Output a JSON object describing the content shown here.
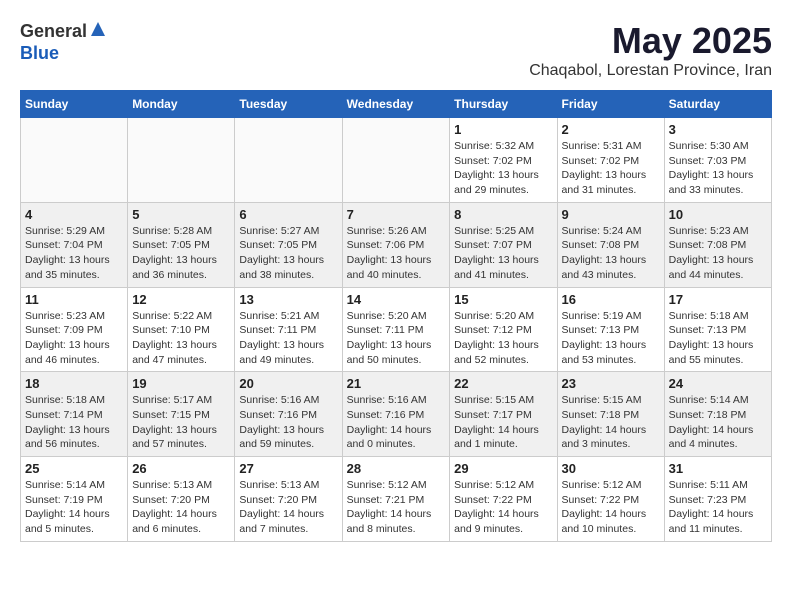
{
  "header": {
    "logo_general": "General",
    "logo_blue": "Blue",
    "month_title": "May 2025",
    "location": "Chaqabol, Lorestan Province, Iran"
  },
  "days_of_week": [
    "Sunday",
    "Monday",
    "Tuesday",
    "Wednesday",
    "Thursday",
    "Friday",
    "Saturday"
  ],
  "weeks": [
    [
      {
        "day": "",
        "info": ""
      },
      {
        "day": "",
        "info": ""
      },
      {
        "day": "",
        "info": ""
      },
      {
        "day": "",
        "info": ""
      },
      {
        "day": "1",
        "info": "Sunrise: 5:32 AM\nSunset: 7:02 PM\nDaylight: 13 hours\nand 29 minutes."
      },
      {
        "day": "2",
        "info": "Sunrise: 5:31 AM\nSunset: 7:02 PM\nDaylight: 13 hours\nand 31 minutes."
      },
      {
        "day": "3",
        "info": "Sunrise: 5:30 AM\nSunset: 7:03 PM\nDaylight: 13 hours\nand 33 minutes."
      }
    ],
    [
      {
        "day": "4",
        "info": "Sunrise: 5:29 AM\nSunset: 7:04 PM\nDaylight: 13 hours\nand 35 minutes."
      },
      {
        "day": "5",
        "info": "Sunrise: 5:28 AM\nSunset: 7:05 PM\nDaylight: 13 hours\nand 36 minutes."
      },
      {
        "day": "6",
        "info": "Sunrise: 5:27 AM\nSunset: 7:05 PM\nDaylight: 13 hours\nand 38 minutes."
      },
      {
        "day": "7",
        "info": "Sunrise: 5:26 AM\nSunset: 7:06 PM\nDaylight: 13 hours\nand 40 minutes."
      },
      {
        "day": "8",
        "info": "Sunrise: 5:25 AM\nSunset: 7:07 PM\nDaylight: 13 hours\nand 41 minutes."
      },
      {
        "day": "9",
        "info": "Sunrise: 5:24 AM\nSunset: 7:08 PM\nDaylight: 13 hours\nand 43 minutes."
      },
      {
        "day": "10",
        "info": "Sunrise: 5:23 AM\nSunset: 7:08 PM\nDaylight: 13 hours\nand 44 minutes."
      }
    ],
    [
      {
        "day": "11",
        "info": "Sunrise: 5:23 AM\nSunset: 7:09 PM\nDaylight: 13 hours\nand 46 minutes."
      },
      {
        "day": "12",
        "info": "Sunrise: 5:22 AM\nSunset: 7:10 PM\nDaylight: 13 hours\nand 47 minutes."
      },
      {
        "day": "13",
        "info": "Sunrise: 5:21 AM\nSunset: 7:11 PM\nDaylight: 13 hours\nand 49 minutes."
      },
      {
        "day": "14",
        "info": "Sunrise: 5:20 AM\nSunset: 7:11 PM\nDaylight: 13 hours\nand 50 minutes."
      },
      {
        "day": "15",
        "info": "Sunrise: 5:20 AM\nSunset: 7:12 PM\nDaylight: 13 hours\nand 52 minutes."
      },
      {
        "day": "16",
        "info": "Sunrise: 5:19 AM\nSunset: 7:13 PM\nDaylight: 13 hours\nand 53 minutes."
      },
      {
        "day": "17",
        "info": "Sunrise: 5:18 AM\nSunset: 7:13 PM\nDaylight: 13 hours\nand 55 minutes."
      }
    ],
    [
      {
        "day": "18",
        "info": "Sunrise: 5:18 AM\nSunset: 7:14 PM\nDaylight: 13 hours\nand 56 minutes."
      },
      {
        "day": "19",
        "info": "Sunrise: 5:17 AM\nSunset: 7:15 PM\nDaylight: 13 hours\nand 57 minutes."
      },
      {
        "day": "20",
        "info": "Sunrise: 5:16 AM\nSunset: 7:16 PM\nDaylight: 13 hours\nand 59 minutes."
      },
      {
        "day": "21",
        "info": "Sunrise: 5:16 AM\nSunset: 7:16 PM\nDaylight: 14 hours\nand 0 minutes."
      },
      {
        "day": "22",
        "info": "Sunrise: 5:15 AM\nSunset: 7:17 PM\nDaylight: 14 hours\nand 1 minute."
      },
      {
        "day": "23",
        "info": "Sunrise: 5:15 AM\nSunset: 7:18 PM\nDaylight: 14 hours\nand 3 minutes."
      },
      {
        "day": "24",
        "info": "Sunrise: 5:14 AM\nSunset: 7:18 PM\nDaylight: 14 hours\nand 4 minutes."
      }
    ],
    [
      {
        "day": "25",
        "info": "Sunrise: 5:14 AM\nSunset: 7:19 PM\nDaylight: 14 hours\nand 5 minutes."
      },
      {
        "day": "26",
        "info": "Sunrise: 5:13 AM\nSunset: 7:20 PM\nDaylight: 14 hours\nand 6 minutes."
      },
      {
        "day": "27",
        "info": "Sunrise: 5:13 AM\nSunset: 7:20 PM\nDaylight: 14 hours\nand 7 minutes."
      },
      {
        "day": "28",
        "info": "Sunrise: 5:12 AM\nSunset: 7:21 PM\nDaylight: 14 hours\nand 8 minutes."
      },
      {
        "day": "29",
        "info": "Sunrise: 5:12 AM\nSunset: 7:22 PM\nDaylight: 14 hours\nand 9 minutes."
      },
      {
        "day": "30",
        "info": "Sunrise: 5:12 AM\nSunset: 7:22 PM\nDaylight: 14 hours\nand 10 minutes."
      },
      {
        "day": "31",
        "info": "Sunrise: 5:11 AM\nSunset: 7:23 PM\nDaylight: 14 hours\nand 11 minutes."
      }
    ]
  ]
}
